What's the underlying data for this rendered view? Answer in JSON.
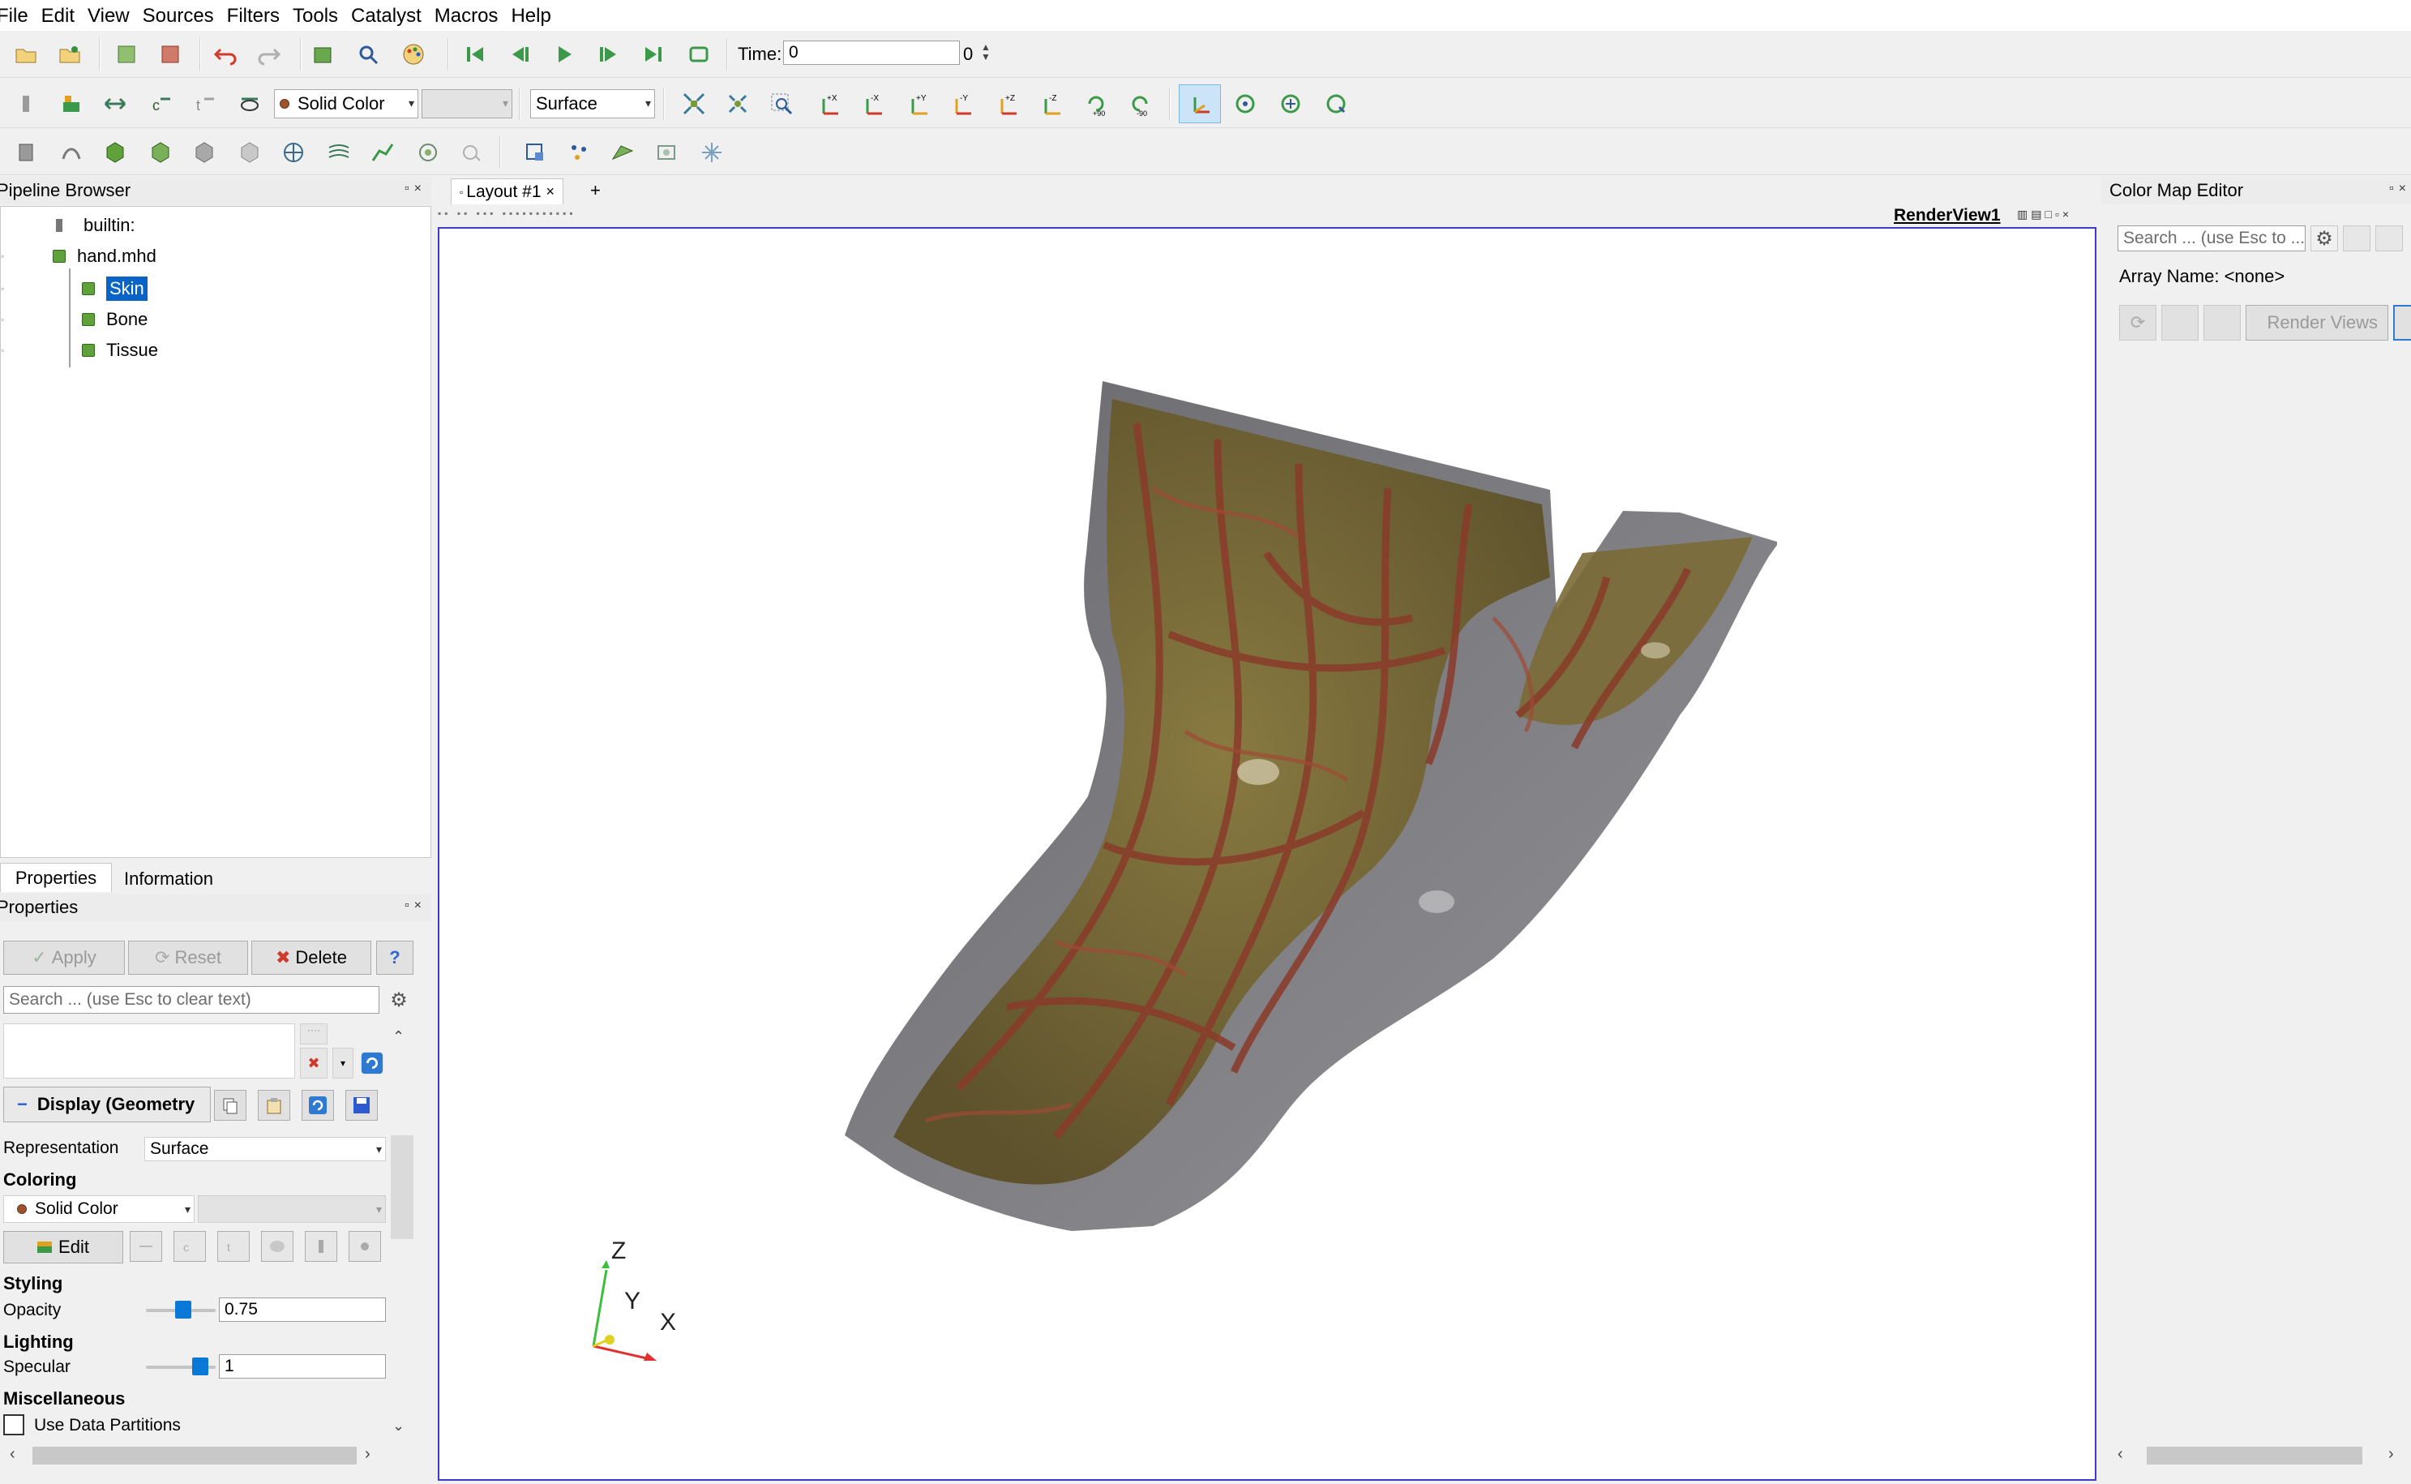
{
  "menu": [
    "File",
    "Edit",
    "View",
    "Sources",
    "Filters",
    "Tools",
    "Catalyst",
    "Macros",
    "Help"
  ],
  "toolbar": {
    "time_label": "Time:",
    "time_value": "0",
    "time_step": "0",
    "coloring_value": "Solid Color",
    "representation_value": "Surface",
    "camera_labels": [
      "+X",
      "-X",
      "+Y",
      "-Y",
      "+Z",
      "-Z",
      "+90",
      "-90"
    ]
  },
  "pipeline": {
    "title": "Pipeline Browser",
    "items": [
      "builtin:",
      "hand.mhd",
      "Skin",
      "Bone",
      "Tissue"
    ]
  },
  "properties_tabs": [
    "Properties",
    "Information"
  ],
  "properties": {
    "title": "Properties",
    "apply": "Apply",
    "reset": "Reset",
    "delete": "Delete",
    "help": "?",
    "search_placeholder": "Search ... (use Esc to clear text)",
    "display_section": "Display (Geometry",
    "representation_label": "Representation",
    "representation_value": "Surface",
    "coloring_head": "Coloring",
    "coloring_value": "Solid Color",
    "edit": "Edit",
    "styling_head": "Styling",
    "opacity_label": "Opacity",
    "opacity_value": "0.75",
    "opacity_fraction": 0.75,
    "lighting_head": "Lighting",
    "specular_label": "Specular",
    "specular_value": "1",
    "specular_fraction": 1.0,
    "misc_head": "Miscellaneous",
    "use_data_partitions": "Use Data Partitions"
  },
  "layout": {
    "tab_label": "Layout #1",
    "add_tab": "+",
    "view_title": "RenderView1"
  },
  "axes": {
    "z": "Z",
    "y": "Y",
    "x": "X"
  },
  "colormap": {
    "title": "Color Map Editor",
    "search_placeholder": "Search ... (use Esc to ...",
    "array_name": "Array Name: <none>",
    "render_views": "Render Views"
  },
  "colors": {
    "accent": "#0a64c8",
    "skin": "#6e6e70",
    "bone": "#6f6235",
    "tissue": "#8a3b2a",
    "render_border": "#3c3ccc"
  }
}
